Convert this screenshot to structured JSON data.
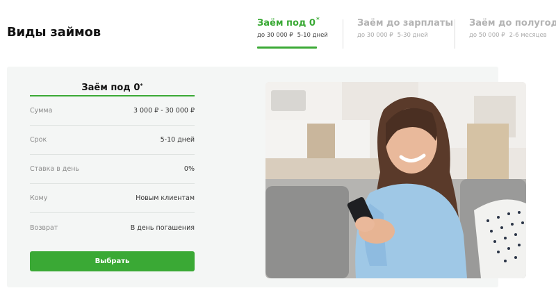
{
  "page": {
    "title": "Виды займов"
  },
  "tabs": [
    {
      "name": "Заём под 0",
      "sup": "*",
      "amount": "до 30 000 ₽",
      "term": "5-10 дней",
      "active": true
    },
    {
      "name": "Заём до зарплаты",
      "amount": "до 30 000 ₽",
      "term": "5-30 дней",
      "active": false
    },
    {
      "name": "Заём до полугода",
      "amount": "до 50 000 ₽",
      "term": "2-6 месяцев",
      "active": false
    }
  ],
  "card": {
    "title": "Заём под 0",
    "title_sup": "*",
    "rows": [
      {
        "key": "Сумма",
        "value": "3 000 ₽ - 30 000 ₽"
      },
      {
        "key": "Срок",
        "value": "5-10 дней"
      },
      {
        "key": "Ставка в день",
        "value": "0%"
      },
      {
        "key": "Кому",
        "value": "Новым клиентам"
      },
      {
        "key": "Возврат",
        "value": "В день погашения"
      }
    ],
    "button_label": "Выбрать"
  },
  "colors": {
    "accent": "#3aa935",
    "panel_bg": "#f4f6f5",
    "inactive_text": "#b3b3b3"
  }
}
